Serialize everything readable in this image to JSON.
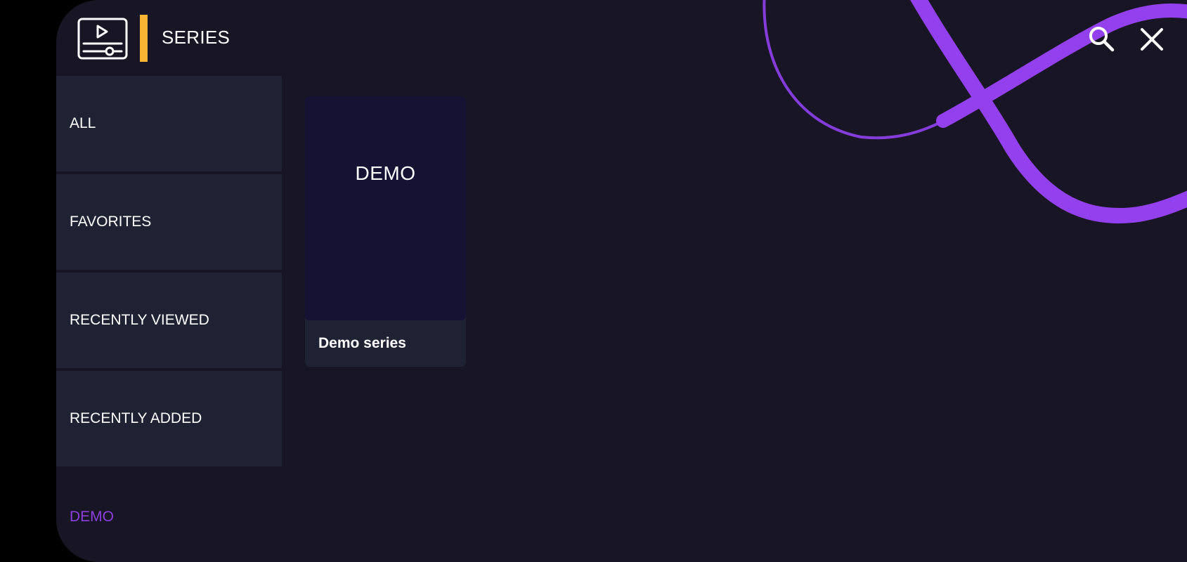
{
  "header": {
    "title": "SERIES",
    "app_icon": "video-player-icon",
    "search_icon": "search-icon",
    "close_icon": "close-icon"
  },
  "sidebar": {
    "items": [
      {
        "label": "ALL"
      },
      {
        "label": "FAVORITES"
      },
      {
        "label": "RECENTLY VIEWED"
      },
      {
        "label": "RECENTLY ADDED"
      },
      {
        "label": "DEMO",
        "active": true
      }
    ]
  },
  "content": {
    "cards": [
      {
        "thumbnail_text": "DEMO",
        "caption": "Demo series"
      }
    ]
  },
  "colors": {
    "background": "#181624",
    "panel": "#1e2233",
    "accent_bar": "#f8b534",
    "active_category": "#8d3fe0",
    "decoration": "#9340ee",
    "thumbnail": "#151234"
  }
}
